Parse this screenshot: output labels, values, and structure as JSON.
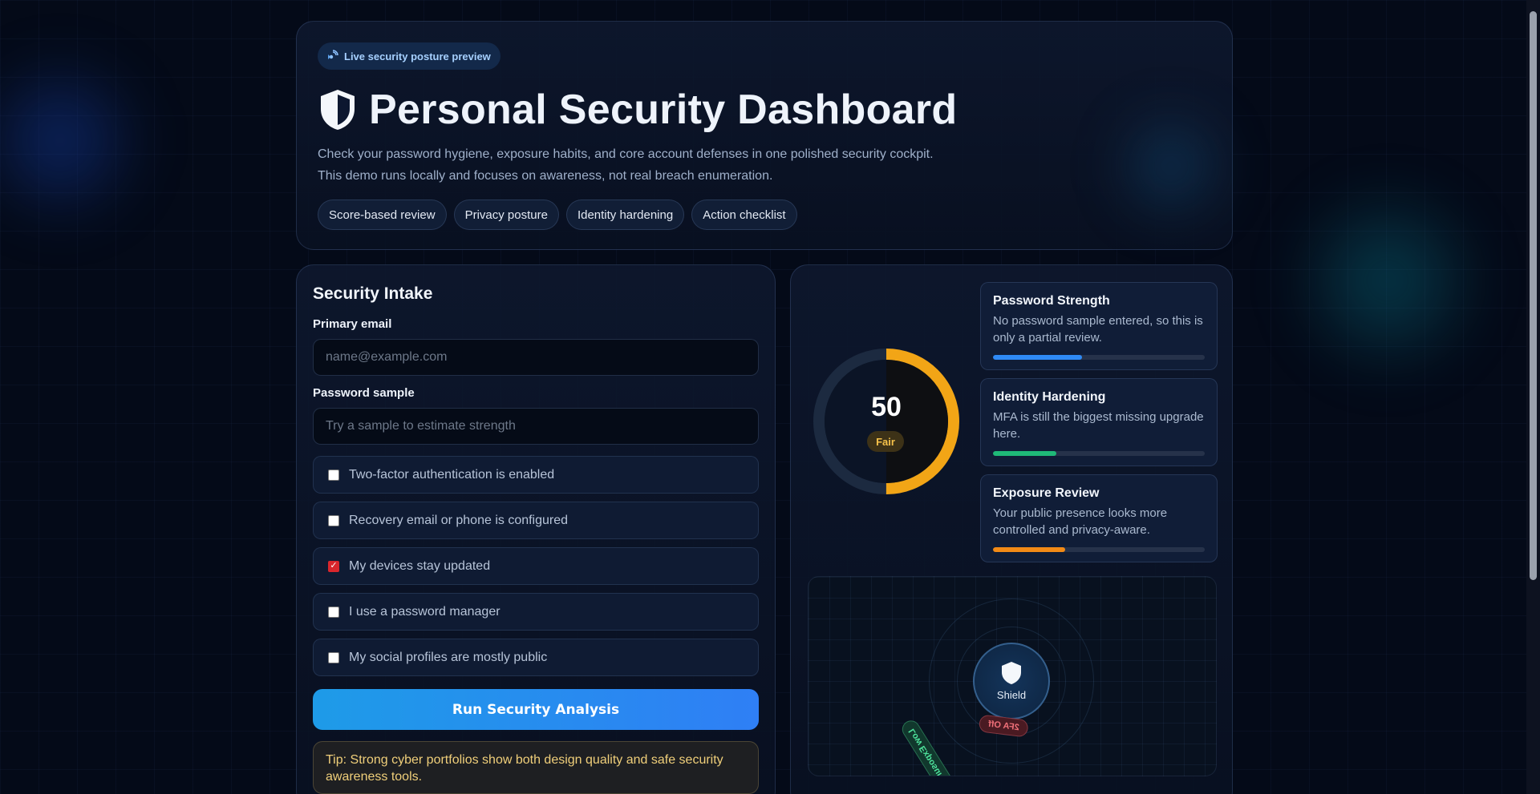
{
  "hero": {
    "badge": "Live security posture preview",
    "title": "Personal Security Dashboard",
    "description_line1": "Check your password hygiene, exposure habits, and core account defenses in one polished security cockpit.",
    "description_line2": "This demo runs locally and focuses on awareness, not real breach enumeration.",
    "chips": [
      "Score-based review",
      "Privacy posture",
      "Identity hardening",
      "Action checklist"
    ]
  },
  "intake": {
    "title": "Security Intake",
    "email_label": "Primary email",
    "email_placeholder": "name@example.com",
    "email_value": "",
    "password_label": "Password sample",
    "password_placeholder": "Try a sample to estimate strength",
    "password_value": "",
    "checks": [
      {
        "label": "Two-factor authentication is enabled",
        "checked": false
      },
      {
        "label": "Recovery email or phone is configured",
        "checked": false
      },
      {
        "label": "My devices stay updated",
        "checked": true
      },
      {
        "label": "I use a password manager",
        "checked": false
      },
      {
        "label": "My social profiles are mostly public",
        "checked": false
      }
    ],
    "run_button": "Run Security Analysis",
    "tip": "Tip: Strong cyber portfolios show both design quality and safe security awareness tools."
  },
  "score": {
    "value": "50",
    "rating": "Fair",
    "fraction": 0.5,
    "color": "#f2a516"
  },
  "metrics": [
    {
      "title": "Password Strength",
      "text": "No password sample entered, so this is only a partial review.",
      "progress": 0.42,
      "color": "#2f8af5"
    },
    {
      "title": "Identity Hardening",
      "text": "MFA is still the biggest missing upgrade here.",
      "progress": 0.3,
      "color": "#1fb978"
    },
    {
      "title": "Exposure Review",
      "text": "Your public presence looks more controlled and privacy-aware.",
      "progress": 0.34,
      "color": "#f28a16"
    }
  ],
  "radar": {
    "center_label": "Shield",
    "tag_low": "Low Exposure",
    "tag_twofa": "2FA Off"
  },
  "colors": {
    "accent": "#2f7ff5",
    "background": "#040a18",
    "warning": "#f0cf7a"
  }
}
